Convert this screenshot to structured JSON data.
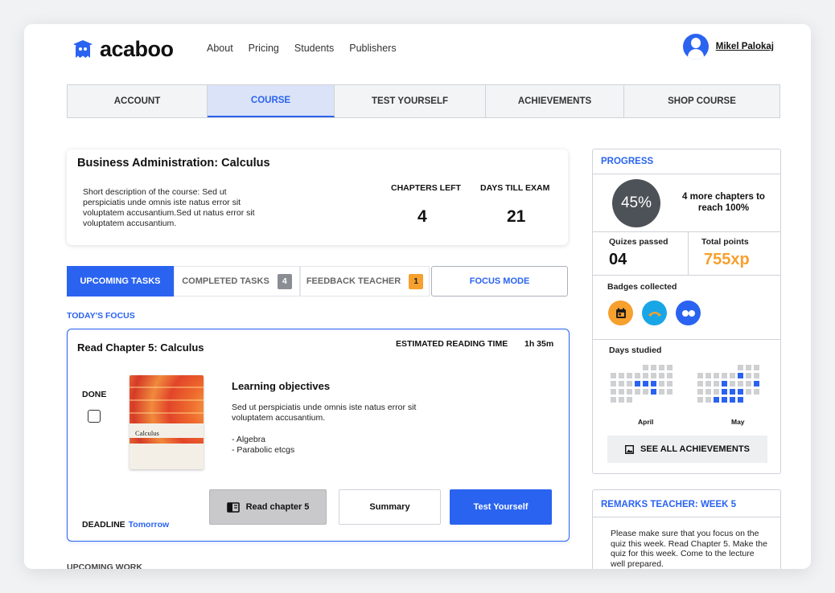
{
  "header": {
    "brand": "acaboo",
    "nav": [
      "About",
      "Pricing",
      "Students",
      "Publishers"
    ],
    "user_name": "Mikel Palokaj"
  },
  "main_tabs": [
    {
      "label": "ACCOUNT",
      "active": false
    },
    {
      "label": "COURSE",
      "active": true
    },
    {
      "label": "TEST YOURSELF",
      "active": false
    },
    {
      "label": "ACHIEVEMENTS",
      "active": false
    },
    {
      "label": "SHOP COURSE",
      "active": false
    }
  ],
  "course": {
    "title": "Business Administration: Calculus",
    "description": "Short description of the course: Sed ut perspiciatis unde omnis iste natus error sit voluptatem accusantium.Sed ut natus error sit voluptatem accusantium.",
    "chapters_left_label": "CHAPTERS LEFT",
    "chapters_left": "4",
    "days_till_exam_label": "DAYS TILL EXAM",
    "days_till_exam": "21"
  },
  "task_tabs": {
    "upcoming": "UPCOMING TASKS",
    "completed": "COMPLETED TASKS",
    "completed_count": "4",
    "feedback": "FEEDBACK TEACHER",
    "feedback_count": "1",
    "focus_mode": "FOCUS MODE"
  },
  "todays_focus": {
    "section_label": "TODAY'S FOCUS",
    "title": "Read Chapter 5: Calculus",
    "est_label": "ESTIMATED READING TIME",
    "est_value": "1h 35m",
    "done_label": "DONE",
    "done": false,
    "book_title": "Calculus",
    "objectives_title": "Learning objectives",
    "objectives_text": "Sed ut perspiciatis unde omnis iste natus error sit voluptatem accusantium.",
    "objectives_list": [
      "- Algebra",
      "- Parabolic etcgs"
    ],
    "deadline_label": "DEADLINE",
    "deadline_value": "Tomorrow",
    "buttons": {
      "read": "Read chapter 5",
      "summary": "Summary",
      "test": "Test Yourself"
    }
  },
  "upcoming_work_label": "UPCOMING WORK",
  "progress": {
    "title": "PROGRESS",
    "percent_label": "45%",
    "percent_value": 45,
    "more_text": "4 more chapters to reach 100%",
    "quizes_label": "Quizes passed",
    "quizes_value": "04",
    "points_label": "Total points",
    "points_value": "755xp",
    "badges_label": "Badges collected",
    "days_label": "Days studied",
    "months": [
      {
        "name": "April",
        "rows": [
          "....gggg",
          "gggggggg",
          "gggbbbgg",
          "gggggbgg",
          "ggg....."
        ]
      },
      {
        "name": "May",
        "rows": [
          ".....ggg",
          "gggggbgg",
          "gggbgggb",
          "gggbbbgg",
          "ggbbbb.."
        ]
      }
    ],
    "achievements_button": "SEE ALL ACHIEVEMENTS"
  },
  "remarks": {
    "title": "REMARKS TEACHER: WEEK 5",
    "text": "Please make sure that you focus on the quiz this week. Read Chapter 5. Make the quiz for this week. Come to the lecture well prepared."
  },
  "colors": {
    "accent": "#2a63f0",
    "orange": "#f6a02e",
    "cyan": "#19a6e6",
    "points": "#f6a02e"
  }
}
